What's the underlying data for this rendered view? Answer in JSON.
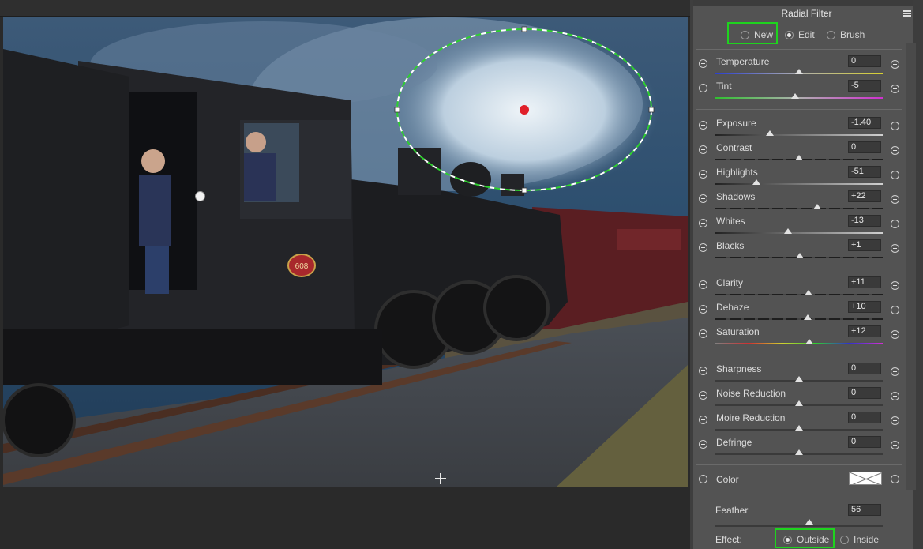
{
  "panel": {
    "title": "Radial Filter",
    "modes": [
      {
        "label": "New",
        "selected": false
      },
      {
        "label": "Edit",
        "selected": true
      },
      {
        "label": "Brush",
        "selected": false
      }
    ],
    "groups": [
      [
        {
          "label": "Temperature",
          "value": "0",
          "track": "temp"
        },
        {
          "label": "Tint",
          "value": "-5",
          "track": "tint"
        }
      ],
      [
        {
          "label": "Exposure",
          "value": "-1.40",
          "track": "gray"
        },
        {
          "label": "Contrast",
          "value": "0",
          "track": "dark"
        },
        {
          "label": "Highlights",
          "value": "-51",
          "track": "gray"
        },
        {
          "label": "Shadows",
          "value": "+22",
          "track": "dark"
        },
        {
          "label": "Whites",
          "value": "-13",
          "track": "gray"
        },
        {
          "label": "Blacks",
          "value": "+1",
          "track": "dark"
        }
      ],
      [
        {
          "label": "Clarity",
          "value": "+11",
          "track": "dark"
        },
        {
          "label": "Dehaze",
          "value": "+10",
          "track": "dark"
        },
        {
          "label": "Saturation",
          "value": "+12",
          "track": "sat"
        }
      ],
      [
        {
          "label": "Sharpness",
          "value": "0",
          "track": "plain"
        },
        {
          "label": "Noise Reduction",
          "value": "0",
          "track": "plain"
        },
        {
          "label": "Moire Reduction",
          "value": "0",
          "track": "plain"
        },
        {
          "label": "Defringe",
          "value": "0",
          "track": "plain"
        }
      ]
    ],
    "color_label": "Color",
    "feather_label": "Feather",
    "feather_value": "56",
    "effect_label": "Effect:",
    "effect_options": [
      {
        "label": "Outside",
        "selected": true
      },
      {
        "label": "Inside",
        "selected": false
      }
    ]
  },
  "photo": {
    "badge": "608"
  },
  "colors": {
    "highlight": "#1ed31e",
    "pin": "#e0202a",
    "panel_bg": "#535353"
  },
  "slider_positions": {
    "Temperature": 0.5,
    "Tint": 0.475,
    "Exposure": 0.325,
    "Contrast": 0.5,
    "Highlights": 0.245,
    "Shadows": 0.61,
    "Whites": 0.435,
    "Blacks": 0.505,
    "Clarity": 0.555,
    "Dehaze": 0.55,
    "Saturation": 0.56,
    "Sharpness": 0.5,
    "Noise Reduction": 0.5,
    "Moire Reduction": 0.5,
    "Defringe": 0.5,
    "Feather": 0.56
  }
}
